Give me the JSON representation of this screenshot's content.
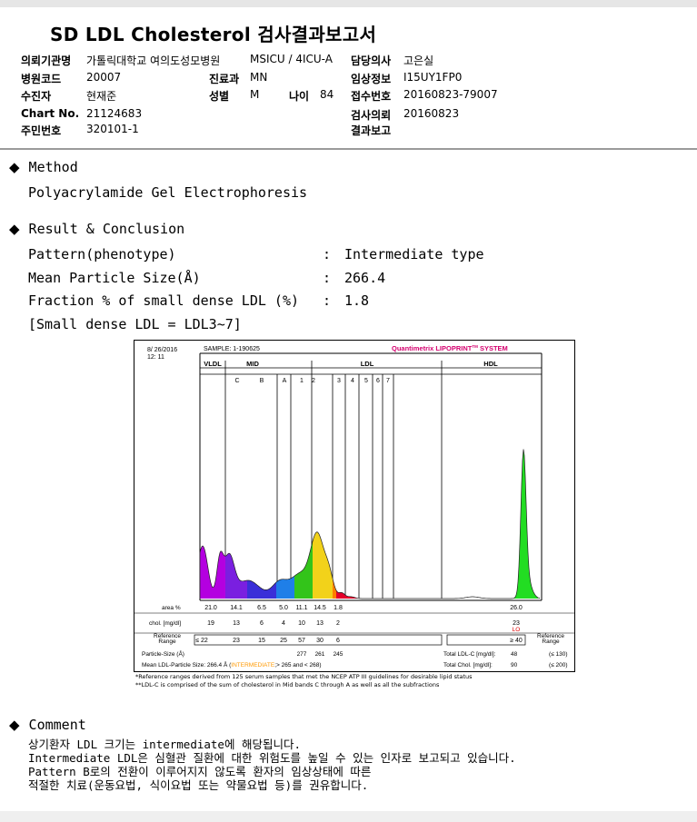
{
  "report": {
    "title": "SD LDL Cholesterol 검사결과보고서",
    "header": {
      "hospital_label": "의뢰기관명",
      "hospital": "가톨릭대학교 여의도성모병원",
      "ward": "MSICU / 4ICU-A",
      "doctor_label": "담당의사",
      "doctor": "고은실",
      "code_label": "병원코드",
      "code": "20007",
      "dept_label": "진료과",
      "dept": "MN",
      "clinical_label": "임상정보",
      "clinical": "I15UY1FP0",
      "patient_label": "수진자",
      "patient": "현재준",
      "sex_label": "성별",
      "sex": "M",
      "age_label": "나이",
      "age": "84",
      "receipt_label": "접수번호",
      "receipt": "20160823-79007",
      "chart_label": "Chart No.",
      "chart": "21124683",
      "request_label": "검사의뢰",
      "request": "20160823",
      "resident_label": "주민번호",
      "resident": "320101-1",
      "result_report_label": "결과보고"
    },
    "method": {
      "heading": "Method",
      "text": "Polyacrylamide Gel Electrophoresis"
    },
    "result": {
      "heading": "Result & Conclusion",
      "rows": [
        {
          "label": "Pattern(phenotype)",
          "colon": ":",
          "value": "Intermediate type"
        },
        {
          "label": "Mean Particle Size(Å)",
          "colon": ":",
          "value": "266.4"
        },
        {
          "label": "Fraction % of small dense LDL (%)",
          "colon": ":",
          "value": "1.8"
        }
      ],
      "note": "[Small dense LDL = LDL3~7]"
    },
    "comment": {
      "heading": "Comment",
      "lines": [
        "상기환자 LDL 크기는 intermediate에 해당됩니다.",
        "Intermediate LDL은 심혈관 질환에 대한 위험도를 높일 수 있는 인자로 보고되고 있습니다.",
        "Pattern B로의 전환이 이루어지지 않도록 환자의 임상상태에 따른",
        "적절한 치료(운동요법, 식이요법 또는 약물요법 등)를 권유합니다."
      ]
    }
  },
  "chart_data": {
    "type": "area",
    "date": "8/ 26/2016",
    "time": "12: 11",
    "sample": "SAMPLE:   1-190625",
    "brand": "Quantimetrix LIPOPRINT",
    "brand_tm": "TM",
    "brand_suffix": " SYSTEM",
    "groups": [
      "VLDL",
      "MID",
      "LDL",
      "HDL"
    ],
    "bands": [
      "C",
      "B",
      "A",
      "1",
      "2",
      "3",
      "4",
      "5",
      "6",
      "7"
    ],
    "area_label": "area %",
    "chol_label": "chol. [mg/dl]",
    "ref_label": "Reference\nRange",
    "ref_label_right": "Reference\nRange",
    "columns": [
      "VLDL",
      "C",
      "B",
      "A",
      "1",
      "2",
      "3+"
    ],
    "area_values": [
      "21.0",
      "14.1",
      "6.5",
      "5.0",
      "11.1",
      "14.5",
      "1.8"
    ],
    "chol_values": [
      "19",
      "13",
      "6",
      "4",
      "10",
      "13",
      "2"
    ],
    "ref_values": [
      "≤ 22",
      "23",
      "15",
      "25",
      "57",
      "30",
      "6"
    ],
    "hdl_area": "26.0",
    "hdl_chol": "23",
    "hdl_flag": "LO",
    "hdl_ref": "≥ 40",
    "particle_label": "Particle-Size (Å)",
    "particle_values": [
      "277",
      "261",
      "245"
    ],
    "mean_label": "Mean LDL-Particle Size:",
    "mean_value": "266.4 Å",
    "mean_type": "INTERMEDIATE",
    "mean_range": ";> 265 and < 268)",
    "total_ldl_label": "Total LDL-C [mg/dl]:",
    "total_ldl": "48",
    "total_ldl_ref": "(≤ 130)",
    "total_chol_label": "Total Chol. [mg/dl]:",
    "total_chol": "90",
    "total_chol_ref": "(≤ 200)",
    "footnote1": "*Reference ranges derived from 125 serum samples that met the NCEP ATP III guidelines for desirable lipid status",
    "footnote2": "**LDL-C is comprised of the sum of cholesterol in Mid bands C through A as well as all the subfractions",
    "colors": {
      "vldl": "#b400e0",
      "c": "#7a1fe0",
      "b": "#3a2fd8",
      "a": "#1f7fe8",
      "ldl1": "#33c41a",
      "ldl2": "#f2d21a",
      "ldl3": "#ff7f00",
      "ldl47": "#e4002a",
      "hdl": "#22dd22",
      "brand": "#d4006e",
      "intermediate": "#ff9900"
    }
  }
}
